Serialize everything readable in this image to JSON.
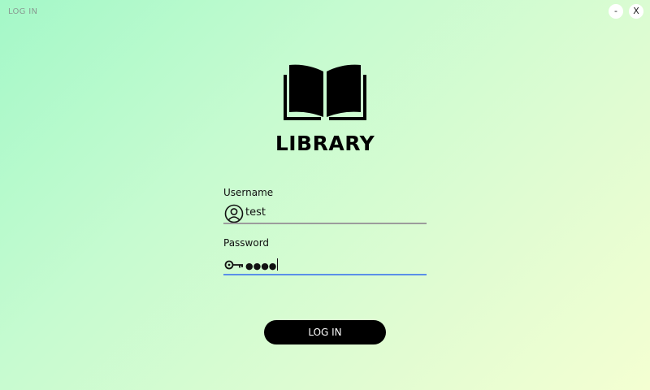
{
  "window": {
    "title": "LOG IN",
    "minimize_label": "-",
    "close_label": "X"
  },
  "brand": {
    "logo_icon": "open-book-icon",
    "name": "LIBRARY"
  },
  "form": {
    "username": {
      "label": "Username",
      "icon": "user-circle-icon",
      "value": "test"
    },
    "password": {
      "label": "Password",
      "icon": "key-icon",
      "value": "●●●●",
      "focused": true
    },
    "submit_label": "LOG IN"
  },
  "colors": {
    "focus_underline": "#5a8fe8",
    "idle_underline": "#9c9c9c",
    "button_bg": "#000000"
  }
}
